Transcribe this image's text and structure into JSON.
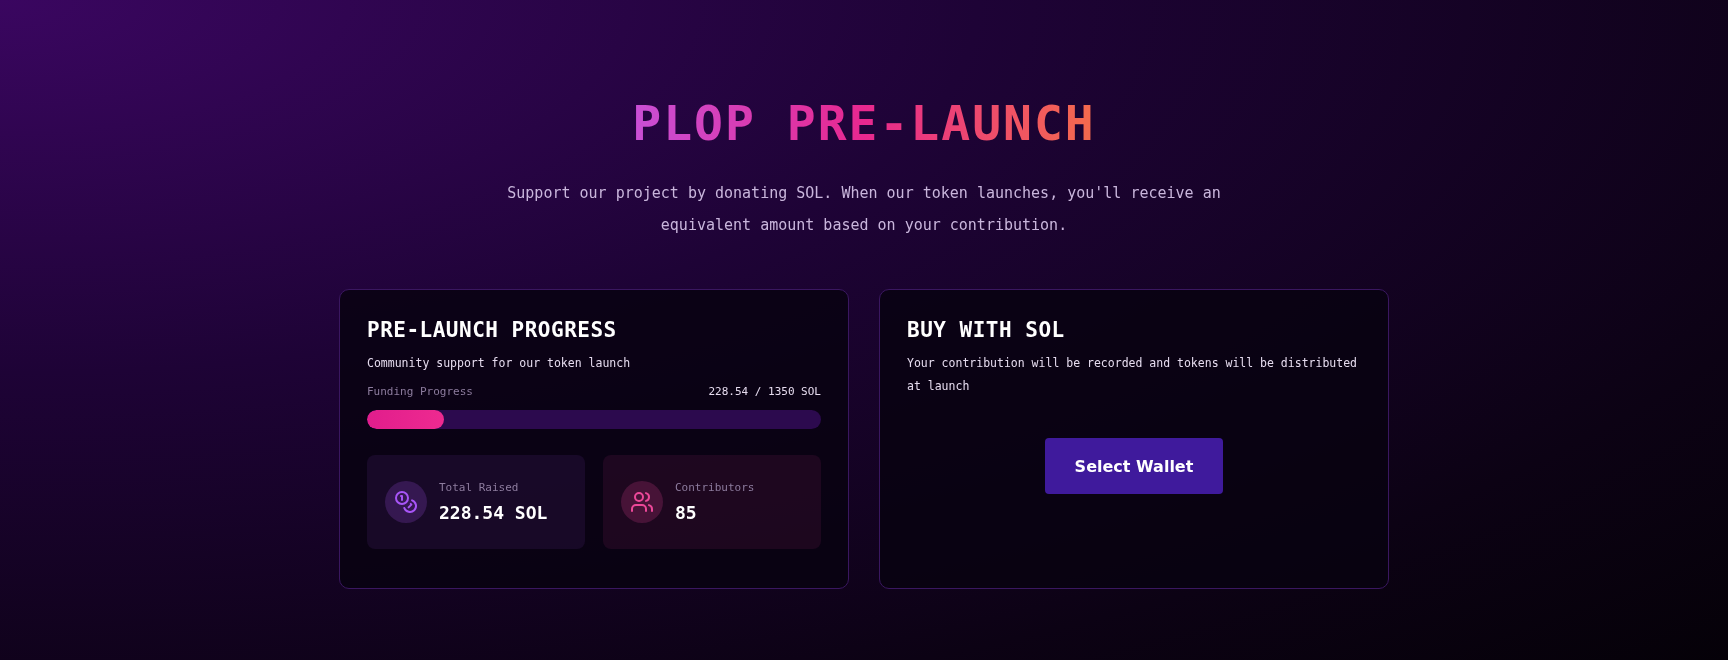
{
  "title": "PLOP PRE-LAUNCH",
  "subtitle": "Support our project by donating SOL. When our token launches, you'll receive an equivalent amount based on your contribution.",
  "progress_card": {
    "heading": "PRE-LAUNCH PROGRESS",
    "description": "Community support for our token launch",
    "progress_label": "Funding Progress",
    "progress_reading": "228.54 / 1350 SOL",
    "level": 0.169,
    "stats": [
      {
        "kind": "coins",
        "label": "Total Raised",
        "value": "228.54 SOL",
        "color": "#a855f7"
      },
      {
        "kind": "users",
        "label": "Contributors",
        "value": "85",
        "color": "#ec4899"
      }
    ]
  },
  "buy_card": {
    "heading": "BUY WITH SOL",
    "description": "Your contribution will be recorded and tokens will be distributed at launch",
    "button": "Select Wallet"
  }
}
